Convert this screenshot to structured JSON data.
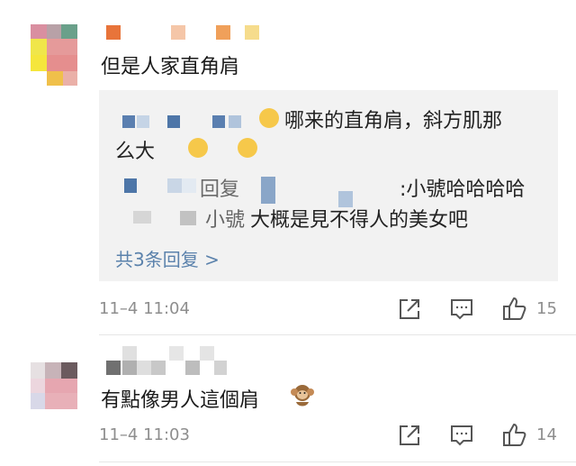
{
  "comments": [
    {
      "text": "但是人家直角肩",
      "timestamp": "11–4 11:04",
      "like_count": "15",
      "replies": [
        {
          "line1": "哪来的直角肩，斜方肌那",
          "line2": "么大"
        },
        {
          "reply_word": "回复",
          "suffix": ":小號哈哈哈哈"
        },
        {
          "prefix": "小號",
          "text": "大概是見不得人的美女吧"
        }
      ],
      "more_replies": "共3条回复 >"
    },
    {
      "text": "有點像男人這個肩",
      "timestamp": "11–4 11:03",
      "like_count": "14"
    }
  ],
  "icons": {
    "share": "share-icon",
    "comment": "comment-icon",
    "like": "thumbs-up-icon"
  },
  "colors": {
    "link": "#5b82ac",
    "meta": "#8e8e8e",
    "reply_bg": "#f2f2f2"
  }
}
